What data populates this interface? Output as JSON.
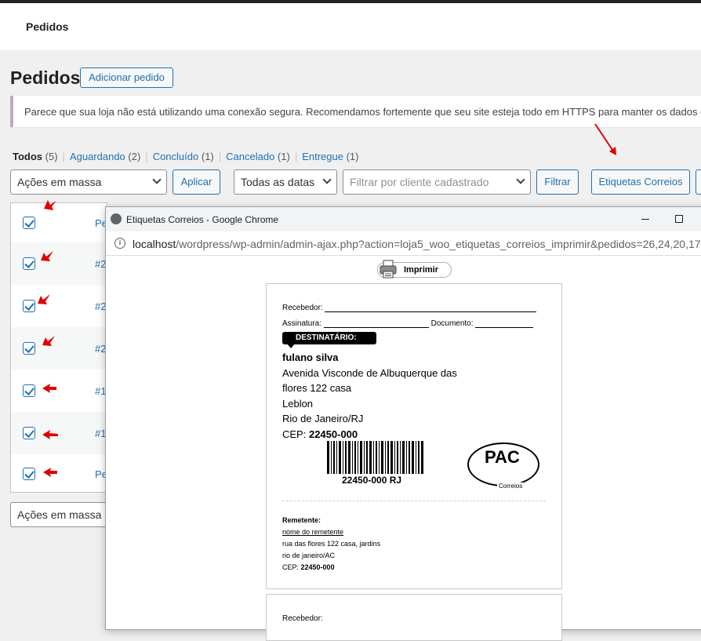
{
  "header": {
    "title": "Pedidos"
  },
  "page": {
    "title": "Pedidos",
    "add_button": "Adicionar pedido",
    "notice": "Parece que sua loja não está utilizando uma conexão segura. Recomendamos fortemente que seu site esteja todo em HTTPS para manter os dados do"
  },
  "filters": {
    "status_links": [
      {
        "label": "Todos",
        "count": "(5)"
      },
      {
        "label": "Aguardando",
        "count": "(2)"
      },
      {
        "label": "Concluído",
        "count": "(1)"
      },
      {
        "label": "Cancelado",
        "count": "(1)"
      },
      {
        "label": "Entregue",
        "count": "(1)"
      }
    ],
    "bulk_actions": "Ações em massa",
    "apply": "Aplicar",
    "dates": "Todas as datas",
    "customer_placeholder": "Filtrar por cliente cadastrado",
    "filter": "Filtrar",
    "etiquetas": "Etiquetas Correios"
  },
  "table": {
    "rows": [
      {
        "link": "Pe"
      },
      {
        "link": "#2"
      },
      {
        "link": "#2"
      },
      {
        "link": "#2"
      },
      {
        "link": "#1"
      },
      {
        "link": "#1"
      },
      {
        "link": "Pe"
      }
    ],
    "bulk_bottom": "Ações em massa"
  },
  "popup": {
    "title": "Etiquetas Correios - Google Chrome",
    "url_host": "localhost",
    "url_path": "/wordpress/wp-admin/admin-ajax.php?action=loja5_woo_etiquetas_correios_imprimir&pedidos=26,24,20,17",
    "print_label": "Imprimir",
    "label": {
      "recebedor": "Recebedor:",
      "assinatura": "Assinatura:",
      "documento": "Documento:",
      "destinatario": "DESTINATÁRIO:",
      "name": "fulano silva",
      "address_lines": [
        "Avenida Visconde de Albuquerque das",
        "flores 122 casa",
        "Leblon",
        "Rio de Janeiro/RJ"
      ],
      "cep_label": "CEP:",
      "cep_value": "22450-000",
      "barcode_text": "22450-000 RJ",
      "pac": "PAC",
      "correios": "Correios",
      "remetente": "Remetente:",
      "sender_name": "nome do remetente",
      "sender_street": "rua das flores 122 casa, jardins",
      "sender_city": "rio de janeiro/AC",
      "sender_cep_label": "CEP:",
      "sender_cep_value": "22450-000"
    },
    "label2": {
      "recebedor": "Recebedor:"
    }
  },
  "colors": {
    "accent": "#2271b1",
    "annotation_arrow": "#e00000"
  }
}
